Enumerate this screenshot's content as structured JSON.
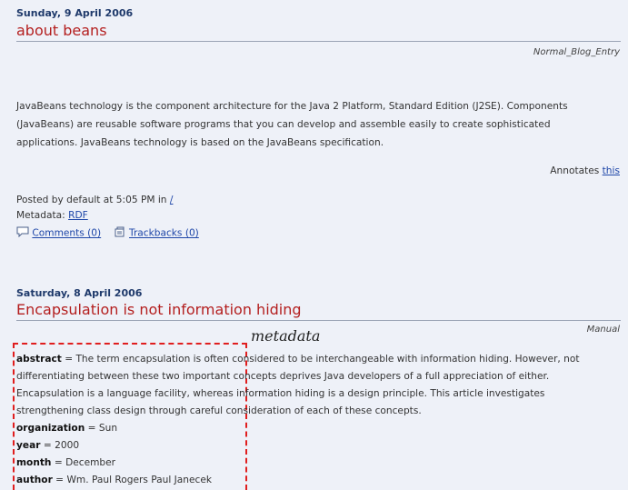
{
  "post1": {
    "date": "Sunday, 9 April 2006",
    "title": "about beans",
    "category": "Normal_Blog_Entry",
    "body": "JavaBeans technology is the component architecture for the Java 2 Platform, Standard Edition (J2SE). Components (JavaBeans) are reusable software programs that you can develop and assemble easily to create sophisticated applications. JavaBeans technology is based on the JavaBeans specification.",
    "annotates_label": "Annotates",
    "annotates_link": "this",
    "posted_prefix": "Posted by default at 5:05 PM in",
    "posted_link": "/",
    "metadata_label": "Metadata:",
    "metadata_link": "RDF",
    "comments_link": "Comments (0)",
    "trackbacks_link": "Trackbacks (0)"
  },
  "post2": {
    "date": "Saturday, 8 April 2006",
    "title": "Encapsulation is not information hiding",
    "category": "Manual",
    "overlay_label": "metadata",
    "abstract_key": "abstract",
    "abstract_value": "The term encapsulation is often considered to be interchangeable with information hiding. However, not differentiating between these two important concepts deprives Java developers of a full appreciation of either. Encapsulation is a language facility, whereas information hiding is a design principle. This article investigates strengthening class design through careful consideration of each of these concepts.",
    "fields": [
      {
        "key": "organization",
        "value": "Sun"
      },
      {
        "key": "year",
        "value": "2000"
      },
      {
        "key": "month",
        "value": "December"
      },
      {
        "key": "author",
        "value": "Wm. Paul Rogers Paul Janecek"
      }
    ]
  },
  "colors": {
    "background": "#eef1f8",
    "title": "#b41f1f",
    "date": "#1f3a6b",
    "link": "#1e46a8",
    "dashed_box": "#e01e1e"
  }
}
